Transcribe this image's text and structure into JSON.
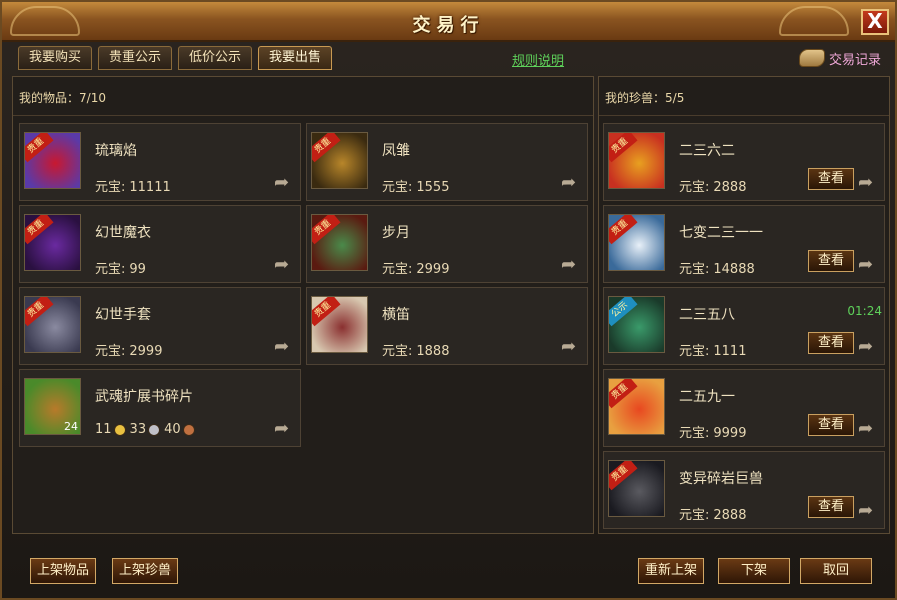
{
  "window": {
    "title": "交易行",
    "close_label": "X"
  },
  "tabs": [
    {
      "label": "我要购买",
      "active": false
    },
    {
      "label": "贵重公示",
      "active": false
    },
    {
      "label": "低价公示",
      "active": false
    },
    {
      "label": "我要出售",
      "active": true
    }
  ],
  "rules_link": "规则说明",
  "trade_record": "交易记录",
  "left_panel": {
    "header_label": "我的物品：",
    "header_count": "7/10",
    "price_label": "元宝:",
    "items": [
      {
        "name": "琉璃焰",
        "price": "11111",
        "badge": "贵重",
        "icon": "fire-gauntlet-icon",
        "colors": [
          "#c81830",
          "#5a3aa8"
        ]
      },
      {
        "name": "凤雏",
        "price": "1555",
        "badge": "贵重",
        "icon": "golden-fan-icon",
        "colors": [
          "#b8862a",
          "#3a2a10"
        ]
      },
      {
        "name": "幻世魔衣",
        "price": "99",
        "badge": "贵重",
        "icon": "purple-armor-icon",
        "colors": [
          "#6a2aa0",
          "#2a1040"
        ]
      },
      {
        "name": "步月",
        "price": "2999",
        "badge": "贵重",
        "icon": "green-fan-icon",
        "colors": [
          "#4a8a4a",
          "#5a1a10"
        ]
      },
      {
        "name": "幻世手套",
        "price": "2999",
        "badge": "贵重",
        "icon": "steel-gauntlet-icon",
        "colors": [
          "#8a8aa0",
          "#3a3a50"
        ]
      },
      {
        "name": "横笛",
        "price": "1888",
        "badge": "贵重",
        "icon": "jade-ring-icon",
        "colors": [
          "#8a3030",
          "#d8c8b0"
        ]
      },
      {
        "name": "武魂扩展书碎片",
        "price": "",
        "badge": "",
        "icon": "treasure-chest-icon",
        "colors": [
          "#b87a2a",
          "#4a8a2a"
        ],
        "stack": "24",
        "coins": [
          {
            "amount": "11",
            "color": "#e8c040"
          },
          {
            "amount": "33",
            "color": "#c0c0c8"
          },
          {
            "amount": "40",
            "color": "#c07040"
          }
        ]
      }
    ]
  },
  "right_panel": {
    "header_label": "我的珍兽：",
    "header_count": "5/5",
    "price_label": "元宝:",
    "view_label": "查看",
    "pets": [
      {
        "name": "二三六二",
        "price": "2888",
        "badge": "贵重",
        "icon": "golden-beast-icon",
        "colors": [
          "#e8a020",
          "#c83020"
        ],
        "timer": ""
      },
      {
        "name": "七变二三一一",
        "price": "14888",
        "badge": "贵重",
        "icon": "white-dragon-icon",
        "colors": [
          "#e8f0f8",
          "#3a6a9a"
        ],
        "timer": ""
      },
      {
        "name": "二三五八",
        "price": "1111",
        "badge": "公示",
        "icon": "green-imp-icon",
        "colors": [
          "#3a9a6a",
          "#1a3a2a"
        ],
        "timer": "01:24"
      },
      {
        "name": "二五九一",
        "price": "9999",
        "badge": "贵重",
        "icon": "red-fish-icon",
        "colors": [
          "#e84820",
          "#e8a040"
        ],
        "timer": ""
      },
      {
        "name": "变异碎岩巨兽",
        "price": "2888",
        "badge": "贵重",
        "icon": "stone-golem-icon",
        "colors": [
          "#5a5a60",
          "#1a1a20"
        ],
        "timer": ""
      }
    ]
  },
  "bottom_buttons": {
    "list_item": "上架物品",
    "list_pet": "上架珍兽",
    "relist": "重新上架",
    "delist": "下架",
    "cancel": "取回"
  }
}
